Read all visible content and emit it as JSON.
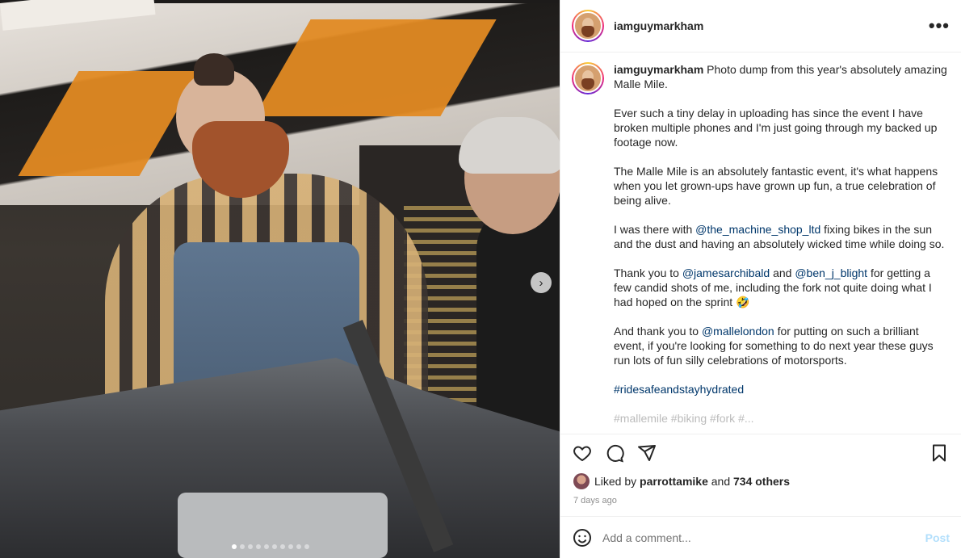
{
  "post": {
    "username": "iamguymarkham",
    "caption": {
      "intro": "Photo dump from this year's absolutely amazing Malle Mile.",
      "p2": "Ever such a tiny delay in uploading has since the event I have broken multiple phones and I'm just going through my backed up footage now.",
      "p3": "The Malle Mile is an absolutely fantastic event, it's what happens when you let grown-ups have grown up fun, a true celebration of being alive.",
      "p4_a": "I was there with ",
      "p4_mention": "@the_machine_shop_ltd",
      "p4_b": " fixing bikes in the sun and the dust and having an absolutely wicked time while doing so.",
      "p5_a": "Thank you to ",
      "p5_mention1": "@jamesarchibald",
      "p5_b": " and ",
      "p5_mention2": "@ben_j_blight",
      "p5_c": " for getting a few candid shots of me, including the fork not quite doing what I had hoped on the sprint 🤣",
      "p6_a": "And thank you to ",
      "p6_mention": "@mallelondon",
      "p6_b": " for putting on such a brilliant event, if you're looking for something to do next year these guys run lots of fun silly celebrations of motorsports.",
      "hashtag": "#ridesafeandstayhydrated",
      "truncated": "#mallemile #biking #fork #..."
    },
    "likes": {
      "prefix": "Liked by ",
      "user": "parrottamike",
      "middle": " and ",
      "others": "734 others"
    },
    "timestamp": "7 days ago",
    "comment_placeholder": "Add a comment...",
    "post_button": "Post"
  },
  "icons": {
    "more": "more-options-icon",
    "next": "chevron-right-icon",
    "like": "heart-icon",
    "comment": "comment-icon",
    "share": "share-icon",
    "save": "bookmark-icon",
    "emoji": "emoji-icon"
  },
  "colors": {
    "mention": "#00376b",
    "post_button_disabled": "#b2dffc",
    "secondary_text": "#8e8e8e"
  },
  "carousel": {
    "slides": 10,
    "active_index": 0
  }
}
